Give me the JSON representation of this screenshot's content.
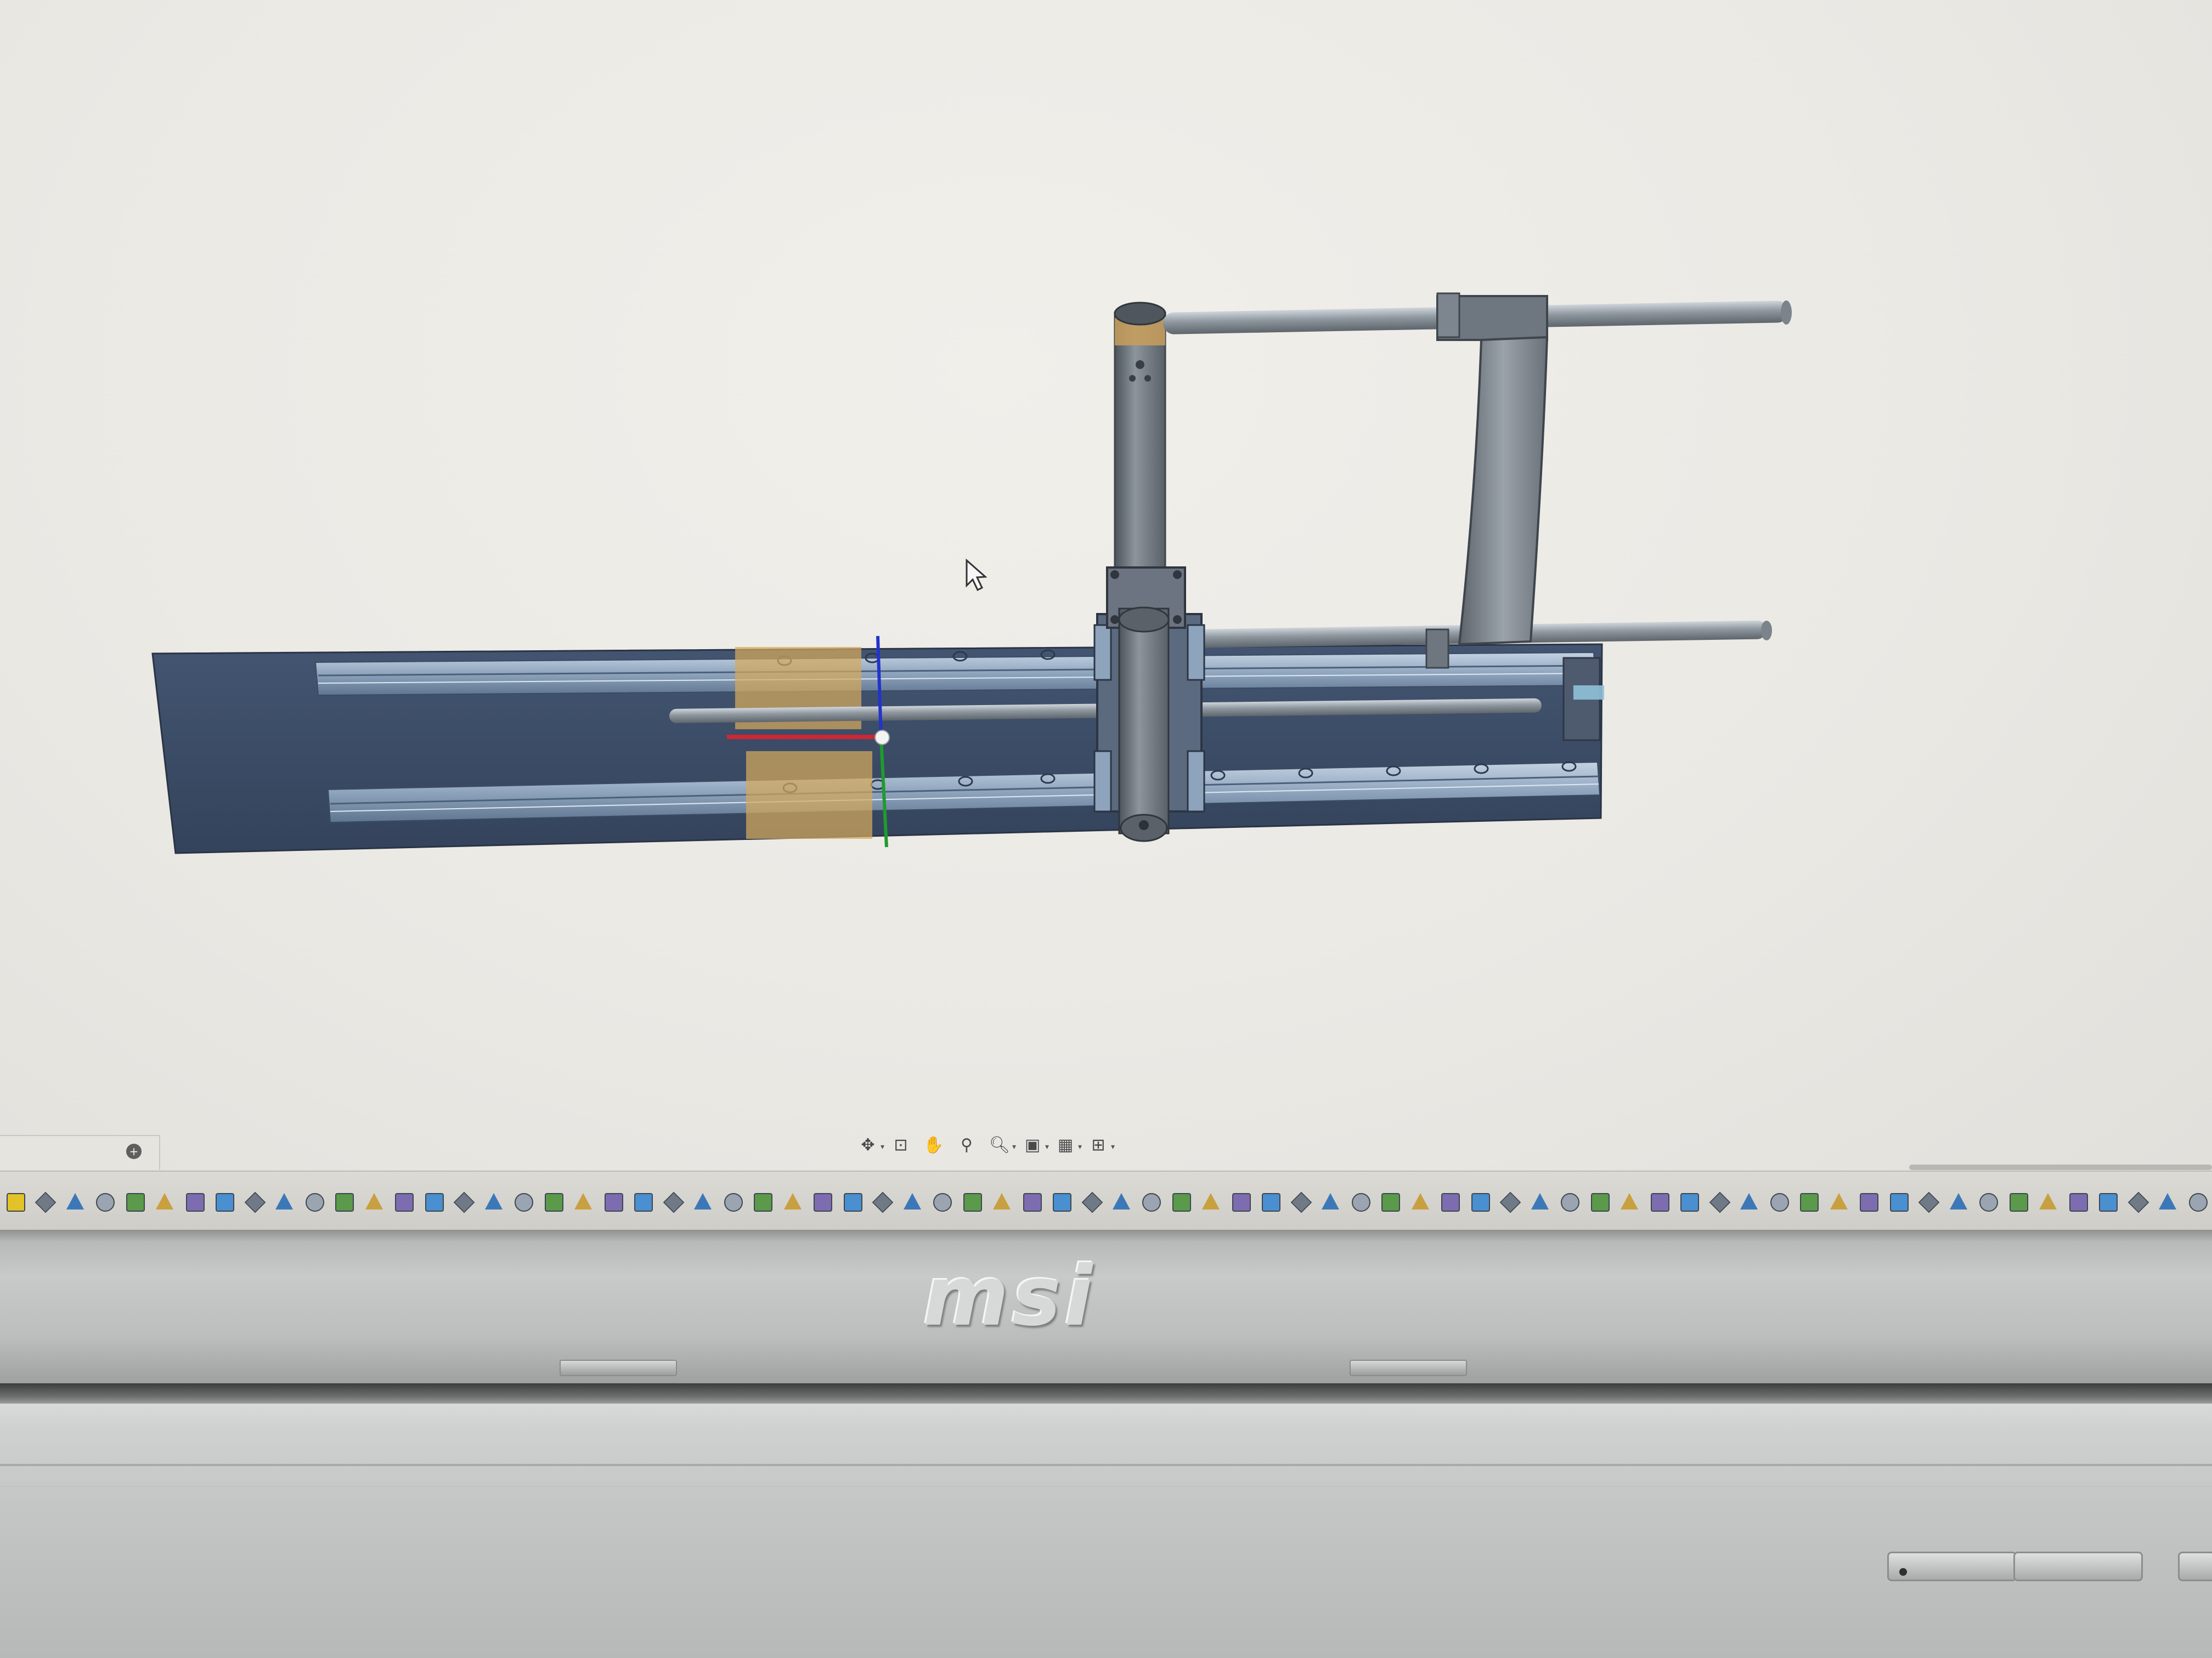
{
  "cad_viewport": {
    "annotation_text": "",
    "triad": {
      "x_color": "#e8202a",
      "y_color": "#1f9b2e",
      "z_color": "#2233cc"
    },
    "model_colors": {
      "base_plate": "#3a4a63",
      "rails": "#a9bcd3",
      "rods": "#9aa3ad",
      "highlight": "#d6a95c"
    }
  },
  "left_panel": {
    "collapse_icon": "plus-circle-icon"
  },
  "view_toolbar": {
    "items": [
      {
        "name": "view-orientation-icon",
        "has_dropdown": true
      },
      {
        "name": "zoom-to-fit-icon",
        "has_dropdown": false
      },
      {
        "name": "pan-hand-icon",
        "has_dropdown": false
      },
      {
        "name": "zoom-in-out-icon",
        "has_dropdown": false
      },
      {
        "name": "zoom-area-icon",
        "has_dropdown": true
      },
      {
        "name": "display-style-icon",
        "has_dropdown": true
      },
      {
        "name": "grid-icon",
        "has_dropdown": true
      },
      {
        "name": "viewports-icon",
        "has_dropdown": true
      }
    ]
  },
  "command_toolbar": {
    "icon_count": 74
  },
  "laptop": {
    "brand": "msi"
  }
}
